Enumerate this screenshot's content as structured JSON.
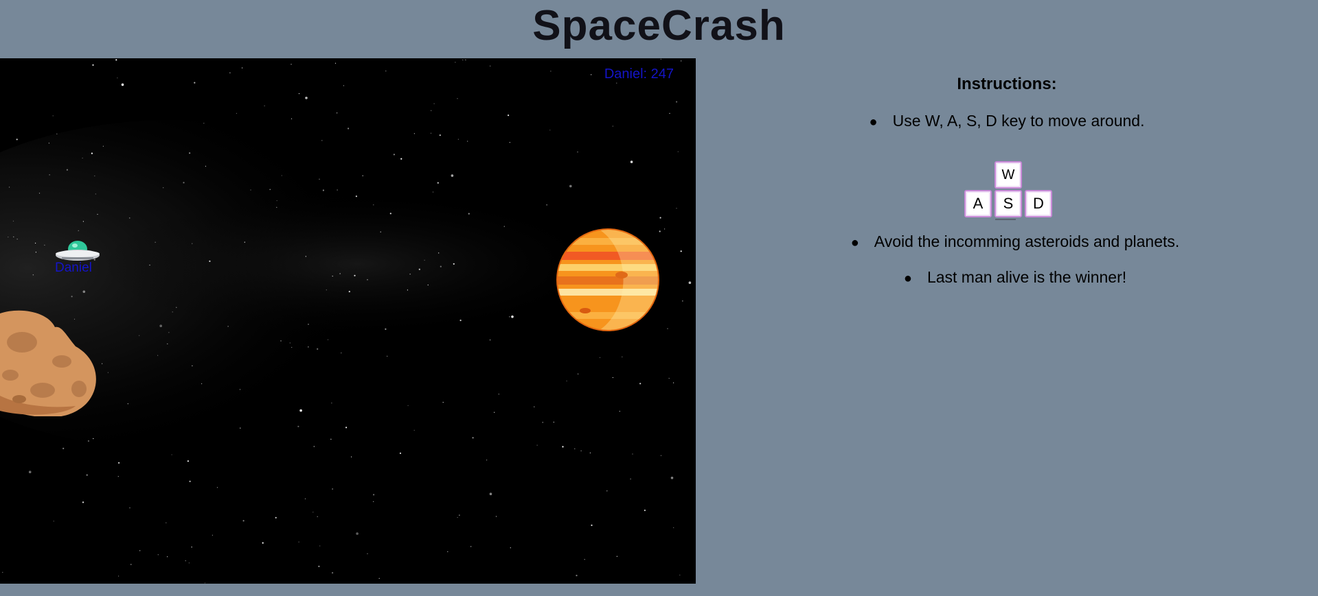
{
  "title": "SpaceCrash",
  "game": {
    "score_label": "Daniel: 247",
    "player_name": "Daniel"
  },
  "instructions": {
    "heading": "Instructions:",
    "items": [
      "Use W, A, S, D key to move around.",
      "Avoid the incomming asteroids and planets.",
      "Last man alive is the winner!"
    ],
    "keys": [
      "W",
      "A",
      "S",
      "D"
    ]
  },
  "colors": {
    "page_background": "#778899",
    "canvas_background": "#000000",
    "player_label": "#1414c8",
    "key_border": "#c98ad8"
  }
}
